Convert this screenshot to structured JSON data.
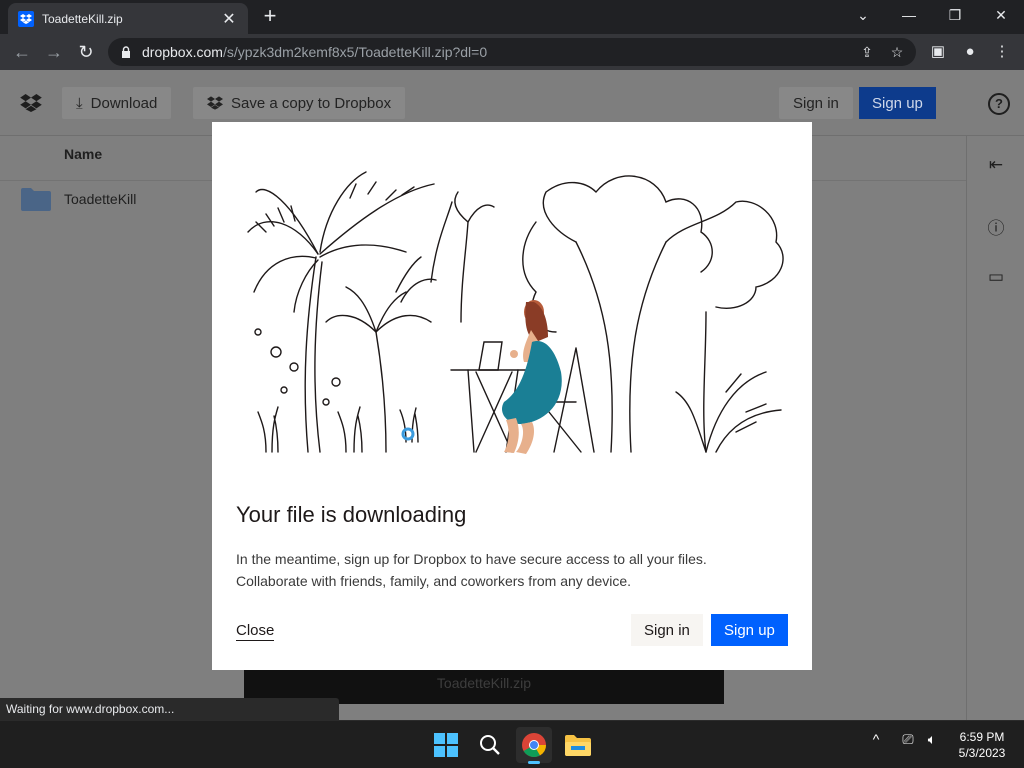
{
  "browser": {
    "tab_title": "ToadetteKill.zip",
    "url_host": "dropbox.com",
    "url_path": "/s/ypzk3dm2kemf8x5/ToadetteKill.zip?dl=0",
    "status_text": "Waiting for www.dropbox.com..."
  },
  "header": {
    "download_label": "Download",
    "save_copy_label": "Save a copy to Dropbox",
    "sign_in_label": "Sign in",
    "sign_up_label": "Sign up"
  },
  "file_list": {
    "column_name": "Name",
    "items": [
      {
        "name": "ToadetteKill"
      }
    ]
  },
  "preview": {
    "filename": "ToadetteKill.zip"
  },
  "modal": {
    "title": "Your file is downloading",
    "body_line1": "In the meantime, sign up for Dropbox to have secure access to all your files.",
    "body_line2": "Collaborate with friends, family, and coworkers from any device.",
    "close_label": "Close",
    "sign_in_label": "Sign in",
    "sign_up_label": "Sign up"
  },
  "taskbar": {
    "time": "6:59 PM",
    "date": "5/3/2023"
  },
  "colors": {
    "brand_blue": "#0061fe",
    "dress_teal": "#1a7f95"
  }
}
